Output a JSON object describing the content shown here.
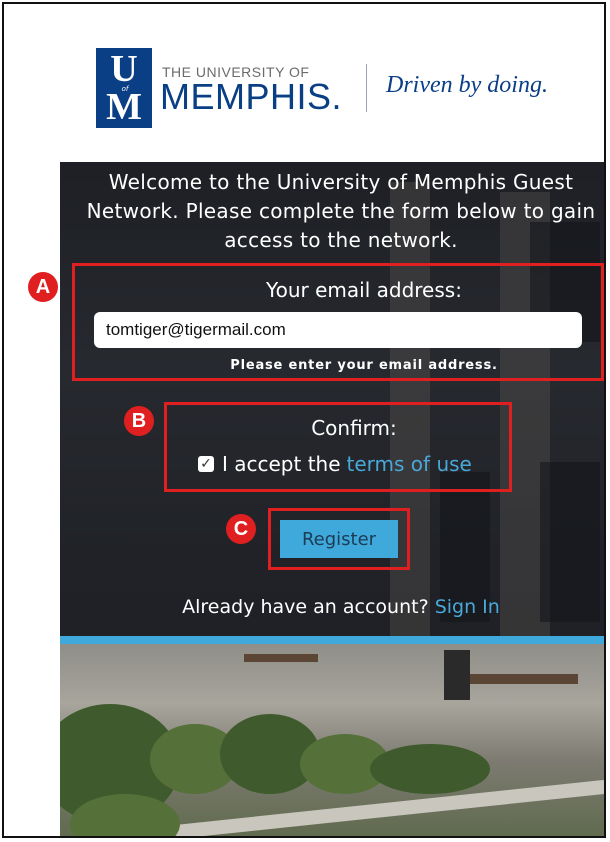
{
  "header": {
    "logo_u": "U",
    "logo_of": "of",
    "logo_m": "M",
    "university_small": "THE UNIVERSITY OF",
    "university_big": "MEMPHIS.",
    "tagline": "Driven by doing."
  },
  "form": {
    "welcome_text": "Welcome to the University of Memphis Guest Network. Please complete the form below to gain access to the network.",
    "email_label": "Your email address:",
    "email_value": "tomtiger@tigermail.com",
    "email_help": "Please enter your email address.",
    "confirm_label": "Confirm:",
    "accept_text": "I accept the",
    "terms_link": "terms of use",
    "checkbox_mark": "✓",
    "register_label": "Register",
    "already_text": "Already have an account?",
    "signin_link": "Sign In"
  },
  "annotations": {
    "a": "A",
    "b": "B",
    "c": "C"
  },
  "colors": {
    "brand_blue": "#0a3f86",
    "accent_blue": "#3fa9dc",
    "annotation_red": "#e02020"
  }
}
